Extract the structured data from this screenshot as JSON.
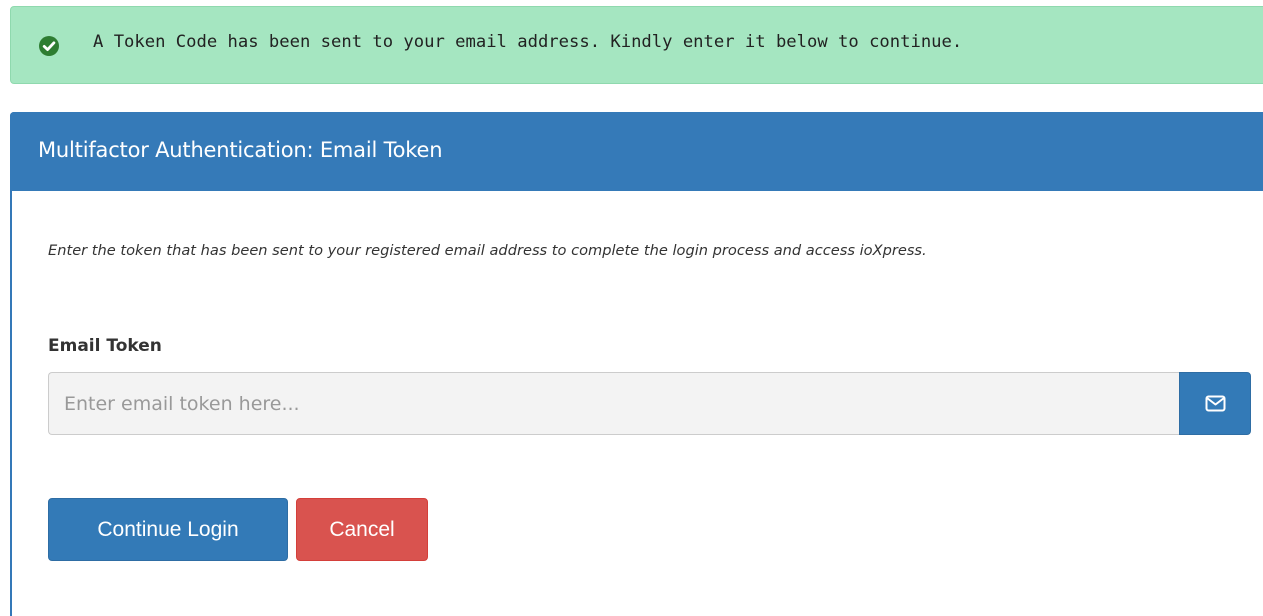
{
  "alert": {
    "icon": "check-circle-icon",
    "message": "A Token Code has been sent to your email address. Kindly enter it below to continue.",
    "background_color": "#a5e6c1",
    "icon_color": "#2e7d32"
  },
  "panel": {
    "title": "Multifactor Authentication: Email Token",
    "heading_color": "#357ab8",
    "description": "Enter the token that has been sent to your registered email address to complete the login process and access ioXpress."
  },
  "form": {
    "token_label": "Email Token",
    "token_placeholder": "Enter email token here...",
    "token_value": "",
    "addon_icon": "envelope-icon"
  },
  "buttons": {
    "continue_label": "Continue Login",
    "continue_color": "#337ab7",
    "cancel_label": "Cancel",
    "cancel_color": "#d9534f"
  }
}
